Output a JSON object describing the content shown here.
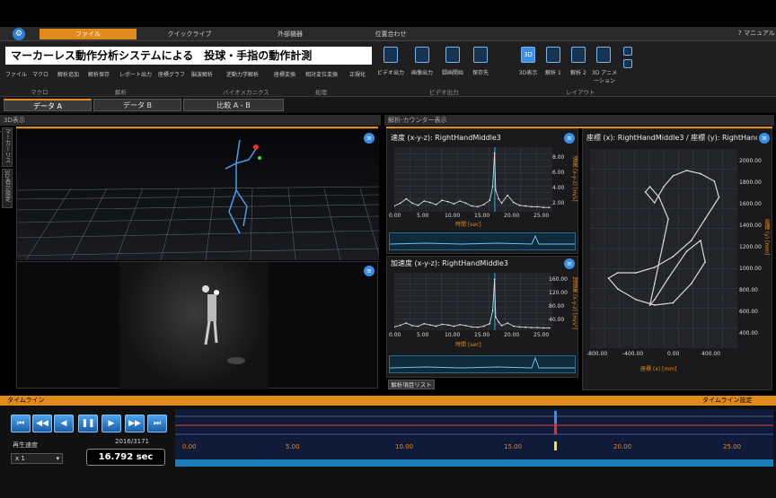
{
  "menu": {
    "tabs": [
      "ファイル",
      "クイックライブ",
      "外部機器",
      "位置合わせ"
    ],
    "active_tab": "ファイル",
    "manual_label": "マニュアル"
  },
  "banner": "マーカーレス動作分析システムによる　投球・手指の動作計測",
  "ribbon": {
    "left_buttons": [
      "ファイル",
      "マクロ",
      "解析追加",
      "解析保存",
      "レポート出力",
      "座標グラフ",
      "脳波解析",
      "逆動力学解析",
      "座標変換",
      "相対変位変換",
      "正規化"
    ],
    "video_buttons": [
      "ビデオ出力",
      "画像出力",
      "録画開始",
      "保存先"
    ],
    "layout_buttons": [
      "3D表示",
      "解析 1",
      "解析 2",
      "3D アニメーション"
    ],
    "groups": [
      "マクロ",
      "解析",
      "バイオメカニクス",
      "処理",
      "ビデオ出力",
      "レイアウト"
    ]
  },
  "data_tabs": [
    "データ A",
    "データ B",
    "比較 A - B"
  ],
  "active_data_tab": "データ A",
  "view3d": {
    "title": "3D表示",
    "side_tabs": [
      "マーカーリスト",
      "3D表示設定"
    ]
  },
  "analysis": {
    "title": "解析-カウンター表示",
    "footer_tab": "解析項目リスト",
    "velocity": {
      "title": "速度 (x-y-z):  RightHandMiddle3",
      "xlabel": "時間 [sec]",
      "ylabel": "速度 (x-y-z) [m/s]",
      "xticks": [
        "0.00",
        "5.00",
        "10.00",
        "15.00",
        "20.00",
        "25.00"
      ],
      "yticks": [
        "8.00",
        "6.00",
        "4.00",
        "2.00"
      ]
    },
    "acceleration": {
      "title": "加速度 (x-y-z):  RightHandMiddle3",
      "xlabel": "時間 [sec]",
      "ylabel": "加速度 (x-y-z) [m/s²]",
      "xticks": [
        "0.00",
        "5.00",
        "10.00",
        "15.00",
        "20.00",
        "25.00"
      ],
      "yticks": [
        "160.00",
        "120.00",
        "80.00",
        "40.00"
      ]
    },
    "coord": {
      "title": "座標 (x):  RightHandMiddle3 / 座標 (y):  RightHandMiddle3",
      "xlabel": "座標 (x) [mm]",
      "ylabel": "座標 (y) [mm]",
      "xticks": [
        "-800.00",
        "-400.00",
        "0.00",
        "400.00"
      ],
      "yticks": [
        "2000.00",
        "1800.00",
        "1600.00",
        "1400.00",
        "1200.00",
        "1000.00",
        "800.00",
        "600.00",
        "400.00"
      ]
    }
  },
  "timeline": {
    "title": "タイムライン",
    "settings_label": "タイムライン設定",
    "speed_label": "再生速度",
    "speed_value": "x 1",
    "frame_counter": "2016/3171",
    "current_time": "16.792 sec",
    "ticks": [
      "0.00",
      "5.00",
      "10.00",
      "15.00",
      "20.00",
      "25.00"
    ],
    "playhead_fraction": 0.636
  },
  "colors": {
    "accent": "#e38a1d",
    "button": "#2b7fd4"
  },
  "chart_data": [
    {
      "type": "line",
      "title": "速度 (x-y-z):  RightHandMiddle3",
      "xlabel": "時間 [sec]",
      "ylabel": "速度 (x-y-z) [m/s]",
      "xlim": [
        0,
        26.5
      ],
      "ylim": [
        0,
        9
      ],
      "series": [
        {
          "x": [
            0,
            1,
            2,
            3,
            4,
            5,
            6,
            7,
            8,
            9,
            10,
            11,
            12,
            13,
            14,
            15,
            16,
            16.5,
            16.8,
            17,
            17.5,
            18,
            19,
            20,
            21,
            22,
            23,
            24,
            25,
            26
          ],
          "values": [
            0.8,
            1.2,
            1.8,
            1.2,
            0.9,
            1.5,
            1.3,
            1.0,
            1.6,
            1.4,
            1.1,
            1.5,
            1.2,
            0.8,
            0.7,
            1.0,
            1.6,
            3.5,
            8.2,
            3.0,
            1.8,
            1.2,
            2.3,
            1.3,
            0.9,
            0.8,
            0.7,
            0.7,
            0.6,
            0.6
          ]
        }
      ]
    },
    {
      "type": "line",
      "title": "加速度 (x-y-z):  RightHandMiddle3",
      "xlabel": "時間 [sec]",
      "ylabel": "加速度 (x-y-z) [m/s²]",
      "xlim": [
        0,
        26.5
      ],
      "ylim": [
        0,
        175
      ],
      "series": [
        {
          "x": [
            0,
            1,
            2,
            3,
            4,
            5,
            6,
            7,
            8,
            9,
            10,
            11,
            12,
            13,
            14,
            15,
            16,
            16.5,
            16.8,
            17,
            17.5,
            18,
            19,
            20,
            21,
            22,
            23,
            24,
            25,
            26
          ],
          "values": [
            10,
            15,
            22,
            14,
            12,
            20,
            16,
            12,
            18,
            16,
            12,
            17,
            14,
            10,
            9,
            12,
            20,
            60,
            155,
            40,
            25,
            14,
            22,
            12,
            10,
            9,
            8,
            8,
            7,
            7
          ]
        }
      ]
    },
    {
      "type": "scatter",
      "title": "座標 (x):  RightHandMiddle3 / 座標 (y):  RightHandMiddle3",
      "xlabel": "座標 (x) [mm]",
      "ylabel": "座標 (y) [mm]",
      "xlim": [
        -900,
        700
      ],
      "ylim": [
        300,
        2150
      ],
      "series": [
        {
          "x": [
            -250,
            -200,
            -150,
            -100,
            -50,
            -150,
            -250,
            -300,
            -200,
            -100,
            0,
            150,
            300,
            450,
            500,
            350,
            200,
            0,
            -200,
            -400,
            -600,
            -700,
            -600,
            -400,
            -200,
            0,
            200,
            350,
            300,
            150,
            -50,
            -200,
            -250
          ],
          "values": [
            700,
            900,
            1100,
            1300,
            1500,
            1700,
            1800,
            1750,
            1650,
            1800,
            1900,
            1950,
            1920,
            1850,
            1700,
            1500,
            1300,
            1150,
            1050,
            1000,
            1000,
            950,
            850,
            750,
            700,
            720,
            900,
            1100,
            1300,
            1200,
            950,
            750,
            700
          ]
        }
      ]
    }
  ]
}
